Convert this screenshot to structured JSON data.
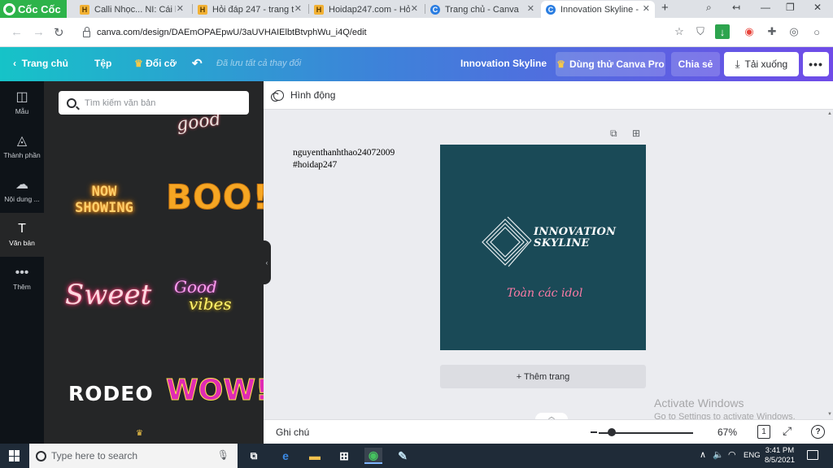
{
  "browser": {
    "logo_text": "Cốc Cốc",
    "tabs": [
      {
        "label": "Calli Nhọc... NI: Cái h",
        "icon": "H"
      },
      {
        "label": "Hỏi đáp 247 - trang t",
        "icon": "H"
      },
      {
        "label": "Hoidap247.com - Hỏ",
        "icon": "H"
      },
      {
        "label": "Trang chủ - Canva",
        "icon": "C"
      },
      {
        "label": "Innovation Skyline - I",
        "icon": "C"
      }
    ],
    "url": "canva.com/design/DAEmOPAEpwU/3aUVHAIElbtBtvphWu_i4Q/edit"
  },
  "canva_header": {
    "home": "Trang chủ",
    "file": "Tệp",
    "resize": "Đổi cỡ",
    "saved_status": "Đã lưu tất cả thay đổi",
    "design_title": "Innovation Skyline",
    "pro_button": "Dùng thử Canva Pro",
    "share_button": "Chia sẻ",
    "download_button": "Tải xuống"
  },
  "rail": {
    "items": [
      {
        "label": "Mẫu",
        "icon": "templates-icon"
      },
      {
        "label": "Thành phần",
        "icon": "elements-icon"
      },
      {
        "label": "Nội dung ...",
        "icon": "uploads-icon"
      },
      {
        "label": "Văn bản",
        "icon": "text-icon"
      },
      {
        "label": "Thêm",
        "icon": "more-icon"
      }
    ]
  },
  "text_panel": {
    "search_placeholder": "Tìm kiếm văn bản",
    "templates": {
      "now_showing": "NOW SHOWING",
      "boo": "BOO!",
      "sweet": "Sweet",
      "good": "Good",
      "vibes": "vibes",
      "rodeo": "RODEO",
      "wow": "WOW!"
    }
  },
  "editor": {
    "animate": "Hình động",
    "notes_line1": "nguyenthanhthao24072009",
    "notes_line2": "#hoidap247",
    "design_title_line1": "INNOVATION",
    "design_title_line2": "SKYLINE",
    "design_subtitle": "Toàn các idol",
    "add_page": "+ Thêm trang",
    "design_bg_color": "#1a4a57"
  },
  "footer": {
    "notes": "Ghi chú",
    "zoom": "67%",
    "zoom_fraction": 0.14,
    "page_count": "1",
    "help": "?"
  },
  "watermark": {
    "line1": "Activate Windows",
    "line2": "Go to Settings to activate Windows."
  },
  "taskbar": {
    "search_placeholder": "Type here to search",
    "language": "ENG",
    "time": "3:41 PM",
    "date": "8/5/2021"
  }
}
